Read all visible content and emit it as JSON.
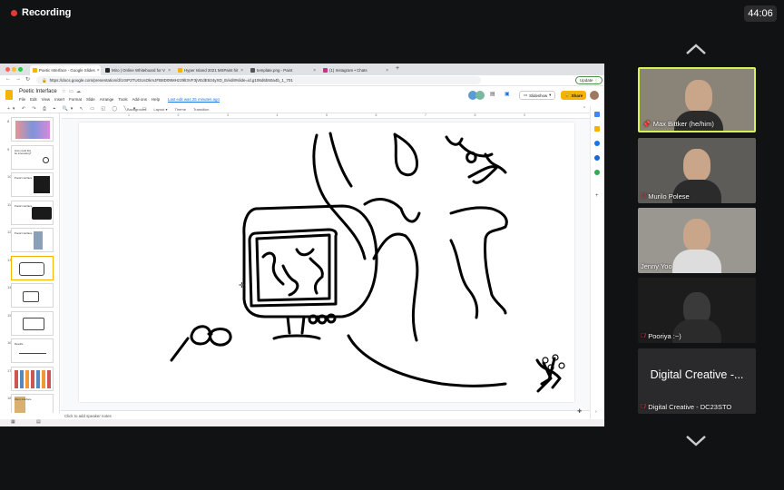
{
  "recording": {
    "label": "Recording"
  },
  "timer": {
    "value": "44:06"
  },
  "browser": {
    "tabs": [
      {
        "label": "Poetic Interface - Google Slides",
        "color": "#f4b400"
      },
      {
        "label": "Miro | Online Whiteboard for V",
        "color": "#222222"
      },
      {
        "label": "Hyper Island 2021 MSPaint hit",
        "color": "#f4b400"
      },
      {
        "label": "template.png - Paint",
        "color": "#555555"
      },
      {
        "label": "(1) Instagram • Chats",
        "color": "#c13584"
      }
    ],
    "url": "https://docs.google.com/presentation/d/1rSP2TUGUsOkmJFB8D09MHz29lI3VF3jVEdE924yXD_E/edit#slide=id.g106d6b50a4b_1_701",
    "update_label": "Update"
  },
  "slides": {
    "doc_title": "Poetic Interface",
    "menus": [
      "File",
      "Edit",
      "View",
      "Insert",
      "Format",
      "Slide",
      "Arrange",
      "Tools",
      "Add-ons",
      "Help"
    ],
    "last_edit": "Last edit was 25 minutes ago",
    "slideshow_label": "Slideshow",
    "share_label": "Share",
    "toolbar_items": [
      "Background",
      "Layout ▾",
      "Theme",
      "Transition"
    ],
    "ruler_ticks": [
      "1",
      "2",
      "3",
      "4",
      "5",
      "6",
      "7",
      "8",
      "9"
    ],
    "speaker_notes_placeholder": "Click to add speaker notes",
    "filmstrip": [
      {
        "num": "8"
      },
      {
        "num": "9",
        "text": "How could this be interesting?"
      },
      {
        "num": "10",
        "text": "Poetic interface"
      },
      {
        "num": "11",
        "text": "Poetic interface"
      },
      {
        "num": "12",
        "text": "Poetic interface"
      },
      {
        "num": "13"
      },
      {
        "num": "14"
      },
      {
        "num": "15"
      },
      {
        "num": "16",
        "text": "Results"
      },
      {
        "num": "17"
      },
      {
        "num": "18",
        "text": "Wavy Interface"
      }
    ]
  },
  "participants": [
    {
      "name": "Max Bittker (he/him)",
      "muted": false,
      "pinned": true,
      "active": true,
      "bg": "#8a8478"
    },
    {
      "name": "Murilo Polese",
      "muted": true,
      "pinned": false,
      "active": false,
      "bg": "#5e5c58"
    },
    {
      "name": "Jenny Yoo",
      "muted": false,
      "pinned": false,
      "active": false,
      "bg": "#9a9690"
    },
    {
      "name": "Pooriya :~)",
      "muted": true,
      "pinned": false,
      "active": false,
      "bg": "#1c1c1c"
    },
    {
      "name": "Digital Creative - DC23STO",
      "tile_text": "Digital Creative -...",
      "muted": true,
      "pinned": false,
      "active": false,
      "bg": "#2a2a2c"
    }
  ],
  "colors": {
    "accent": "#f4b400",
    "active_speaker": "#d7f257",
    "record_red": "#e53935"
  }
}
